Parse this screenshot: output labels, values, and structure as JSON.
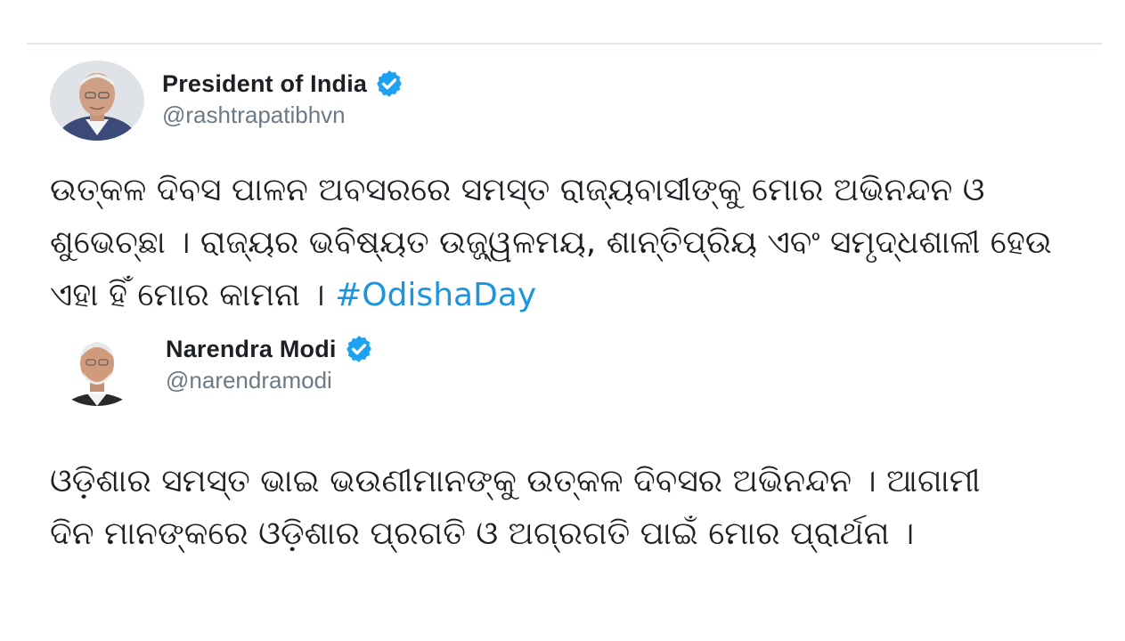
{
  "tweets": [
    {
      "author": {
        "name": "President of India",
        "handle": "@rashtrapatibhvn",
        "verified": true
      },
      "text_lines": [
        "ଉତ୍କଳ ଦିବସ ପାଳନ ଅବସରରେ ସମସ୍ତ ରାଜ୍ୟବାସୀଙ୍କୁ ମୋର ଅଭିନନ୍ଦନ ଓ",
        "ଶୁଭେଚ୍ଛା । ରାଜ୍ୟର ଭବିଷ୍ୟତ ଉଜ୍ଜ୍ୱଳମୟ, ଶାନ୍ତିପ୍ରିୟ ଏବଂ ସମୃଦ୍ଧଶାଳୀ ହେଉ",
        "ଏହା ହିଁ ମୋର କାମନା ।"
      ],
      "hashtag": "#OdishaDay"
    },
    {
      "author": {
        "name": "Narendra Modi",
        "handle": "@narendramodi",
        "verified": true
      },
      "text_lines": [
        "ଓଡ଼ିଶାର ସମସ୍ତ ଭାଇ ଭଉଣୀମାନଙ୍କୁ ଉତ୍କଳ ଦିବସର ଅଭିନନ୍ଦନ । ଆଗାମୀ",
        "ଦିନ ମାନଙ୍କରେ ଓଡ଼ିଶାର ପ୍ରଗତି ଓ ଅଗ୍ରଗତି ପାଇଁ ମୋର ପ୍ରାର୍ଥନା ।"
      ]
    }
  ],
  "icons": {
    "verified": "verified-badge-icon"
  },
  "colors": {
    "verified_badge": "#1da1f2",
    "hashtag": "#1b95e0",
    "handle": "#6c7a86",
    "divider": "#e1e6ea"
  }
}
